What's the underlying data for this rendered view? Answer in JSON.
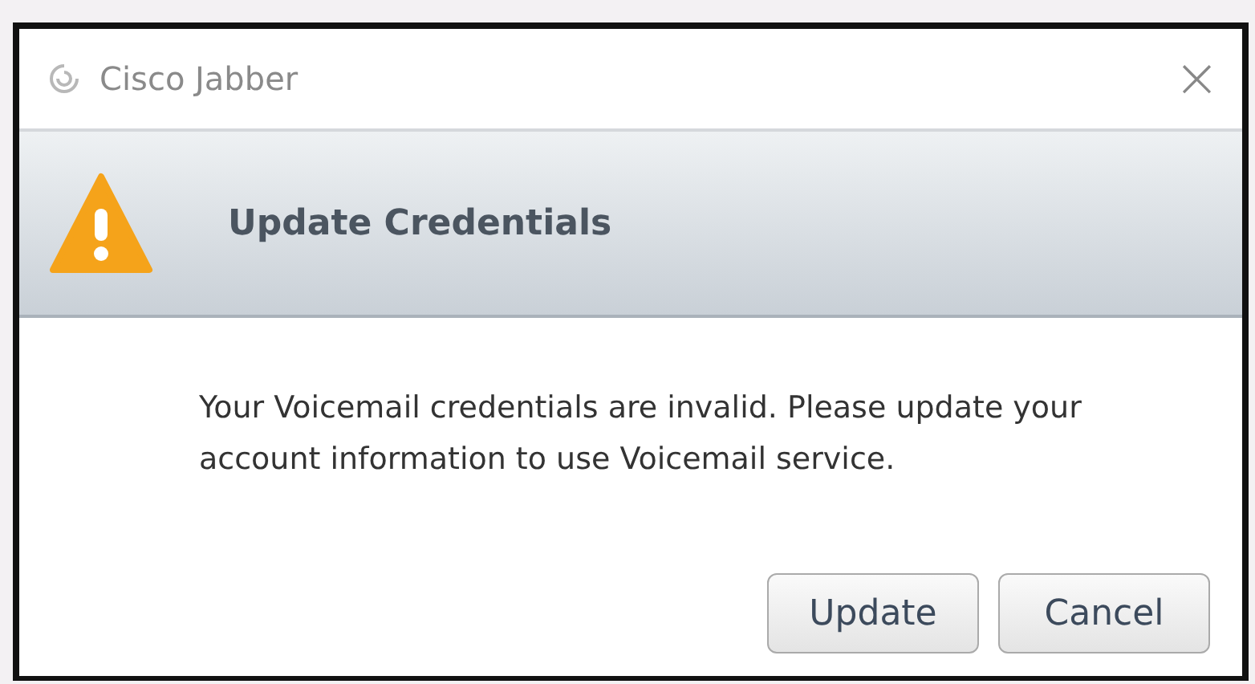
{
  "window": {
    "title": "Cisco Jabber",
    "close": "×"
  },
  "header": {
    "kind": "warning",
    "title": "Update Credentials"
  },
  "message": "Your Voicemail credentials are invalid. Please update your account information to use Voicemail service.",
  "buttons": [
    {
      "label": "Update"
    },
    {
      "label": "Cancel"
    }
  ]
}
